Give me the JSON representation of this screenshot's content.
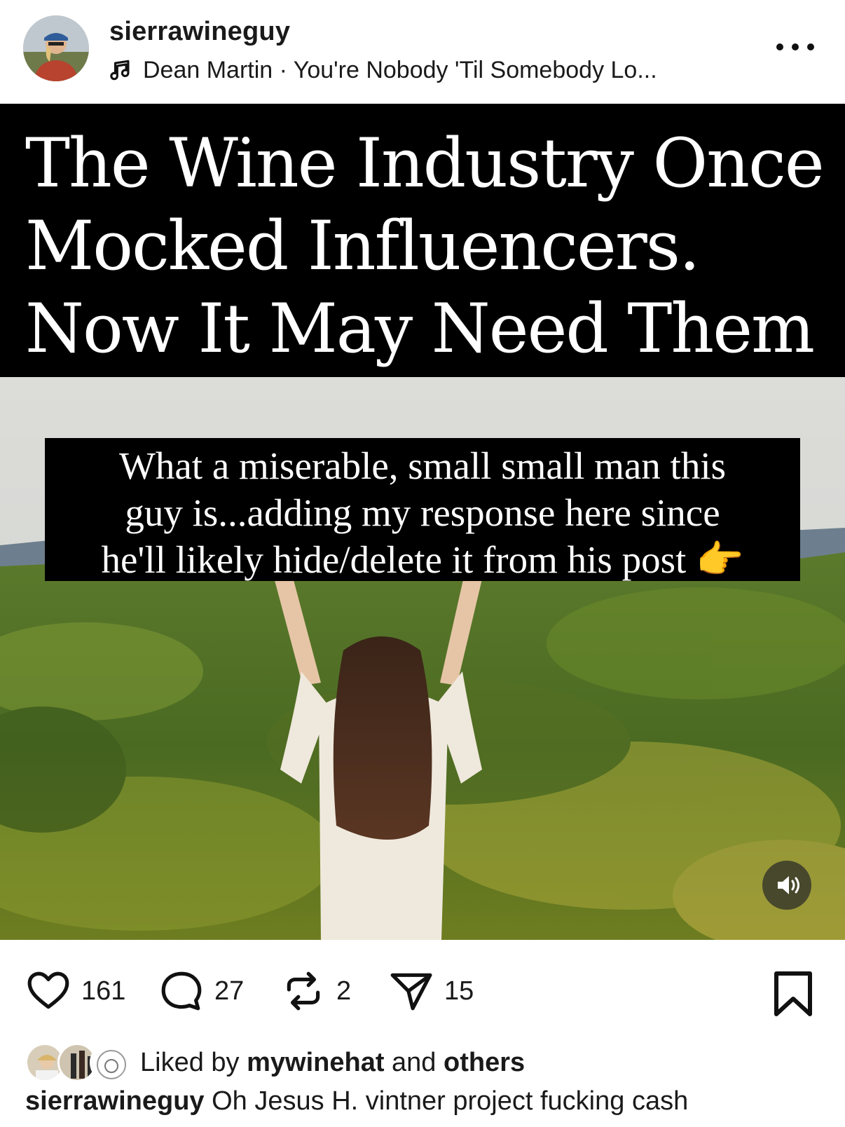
{
  "post": {
    "username": "sierrawineguy",
    "music": {
      "icon": "music-note-icon",
      "text": "Dean Martin · You're Nobody 'Til Somebody Lo..."
    },
    "more_icon": "more-horizontal-icon"
  },
  "media": {
    "headline": "The Wine Industry Once Mocked Influencers. Now It May Need Them",
    "caption_overlay_lines": [
      "What a miserable, small small man this",
      "guy is...adding my response here since",
      "he'll likely hide/delete it from his post 👉"
    ],
    "sound_icon": "speaker-icon"
  },
  "actions": {
    "like_count": "161",
    "comment_count": "27",
    "repost_count": "2",
    "share_count": "15"
  },
  "likes": {
    "prefix": "Liked by ",
    "user": "mywinehat",
    "middle": " and ",
    "others": "others"
  },
  "caption": {
    "username": "sierrawineguy",
    "text": " Oh Jesus H. vintner project fucking cash"
  }
}
